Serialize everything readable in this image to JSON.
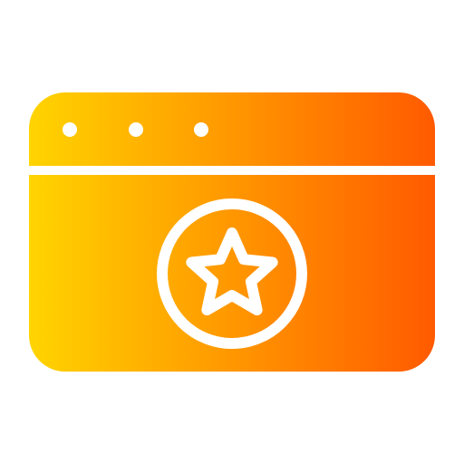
{
  "icon": {
    "name": "browser-window-star-icon",
    "gradient": {
      "start": "#FFD400",
      "end": "#FF5A00"
    },
    "foreground": "#FFFFFF"
  }
}
